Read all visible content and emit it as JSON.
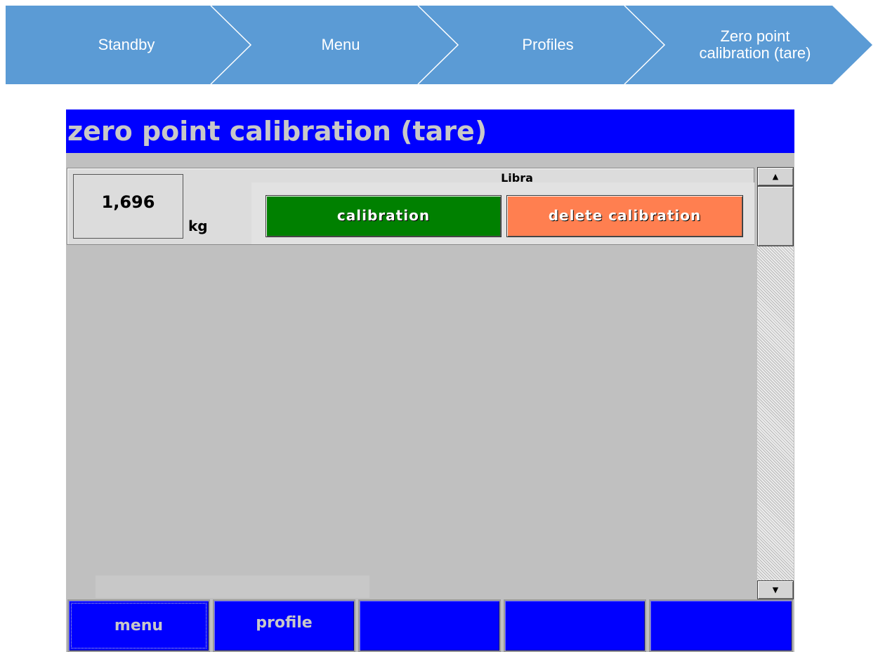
{
  "breadcrumb": {
    "color": "#5b9bd5",
    "steps": [
      {
        "label": "Standby"
      },
      {
        "label": "Menu"
      },
      {
        "label": "Profiles"
      },
      {
        "label_line1": "Zero point",
        "label_line2": "calibration (tare)"
      }
    ]
  },
  "panel": {
    "title": "zero point calibration (tare)",
    "title_bar_color": "#0000ff",
    "rows": [
      {
        "name": "Libra",
        "value": "1,696",
        "unit": "kg",
        "calibration_label": "calibration",
        "delete_label": "delete calibration"
      }
    ],
    "scrollbar": {
      "up_icon": "▲",
      "down_icon": "▼"
    },
    "function_keys": [
      {
        "label": "menu"
      },
      {
        "label": "profile"
      },
      {
        "label": ""
      },
      {
        "label": ""
      },
      {
        "label": ""
      }
    ]
  },
  "colors": {
    "calibration_button": "#008000",
    "delete_button": "#ff7f50",
    "panel_background": "#c0c0c0"
  }
}
